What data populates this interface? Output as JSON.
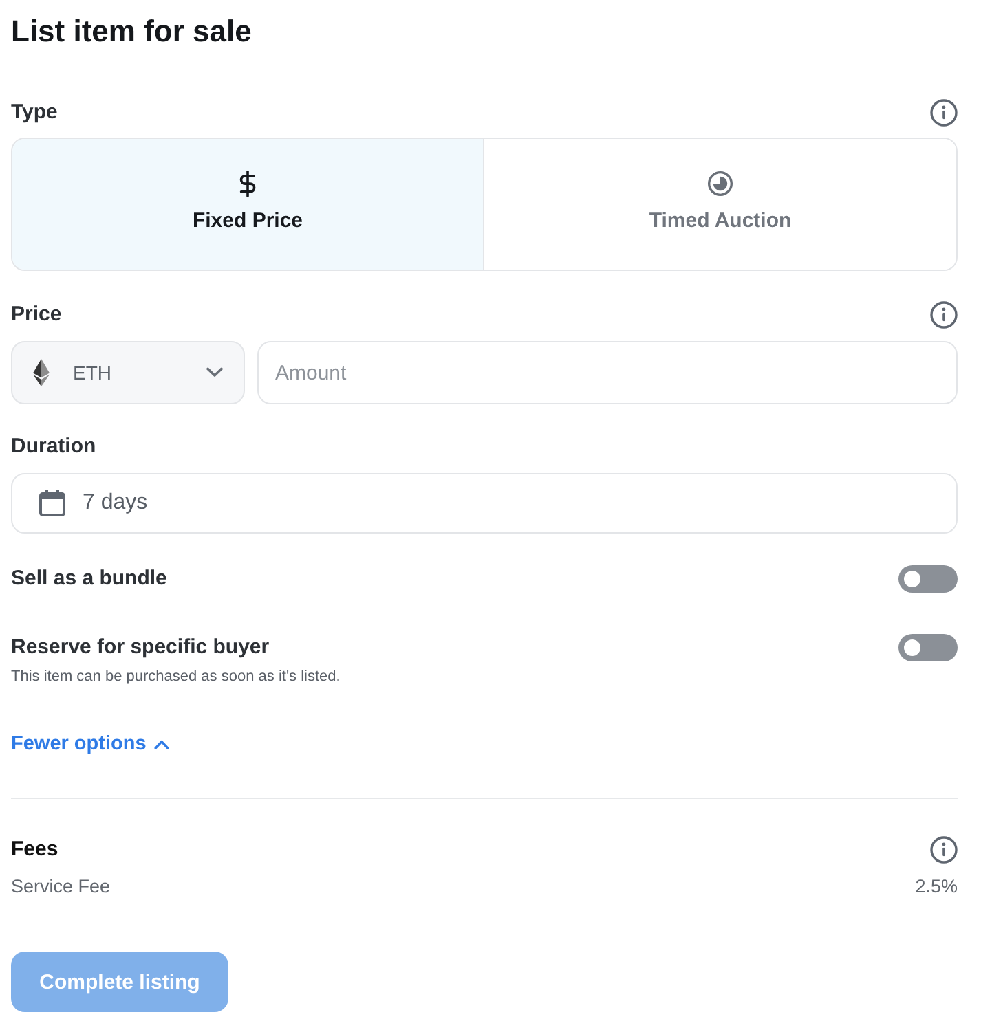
{
  "title": "List item for sale",
  "type": {
    "label": "Type",
    "options": [
      {
        "kind": "fixed_price",
        "label": "Fixed Price",
        "selected": true
      },
      {
        "kind": "timed_auction",
        "label": "Timed Auction",
        "selected": false
      }
    ]
  },
  "price": {
    "label": "Price",
    "currency": "ETH",
    "amount": {
      "placeholder": "Amount"
    }
  },
  "duration": {
    "label": "Duration",
    "value": "7 days"
  },
  "options": [
    {
      "label": "Sell as a bundle",
      "on": false
    },
    {
      "label": "Reserve for specific buyer",
      "on": false,
      "note": "This item can be purchased as soon as it's listed."
    }
  ],
  "options_link": {
    "label": "Fewer options",
    "expanded": true
  },
  "fees": {
    "label": "Fees",
    "items": [
      {
        "label": "Service Fee",
        "value": "2.5%"
      }
    ]
  },
  "submit": {
    "label": "Complete listing",
    "disabled": true
  }
}
